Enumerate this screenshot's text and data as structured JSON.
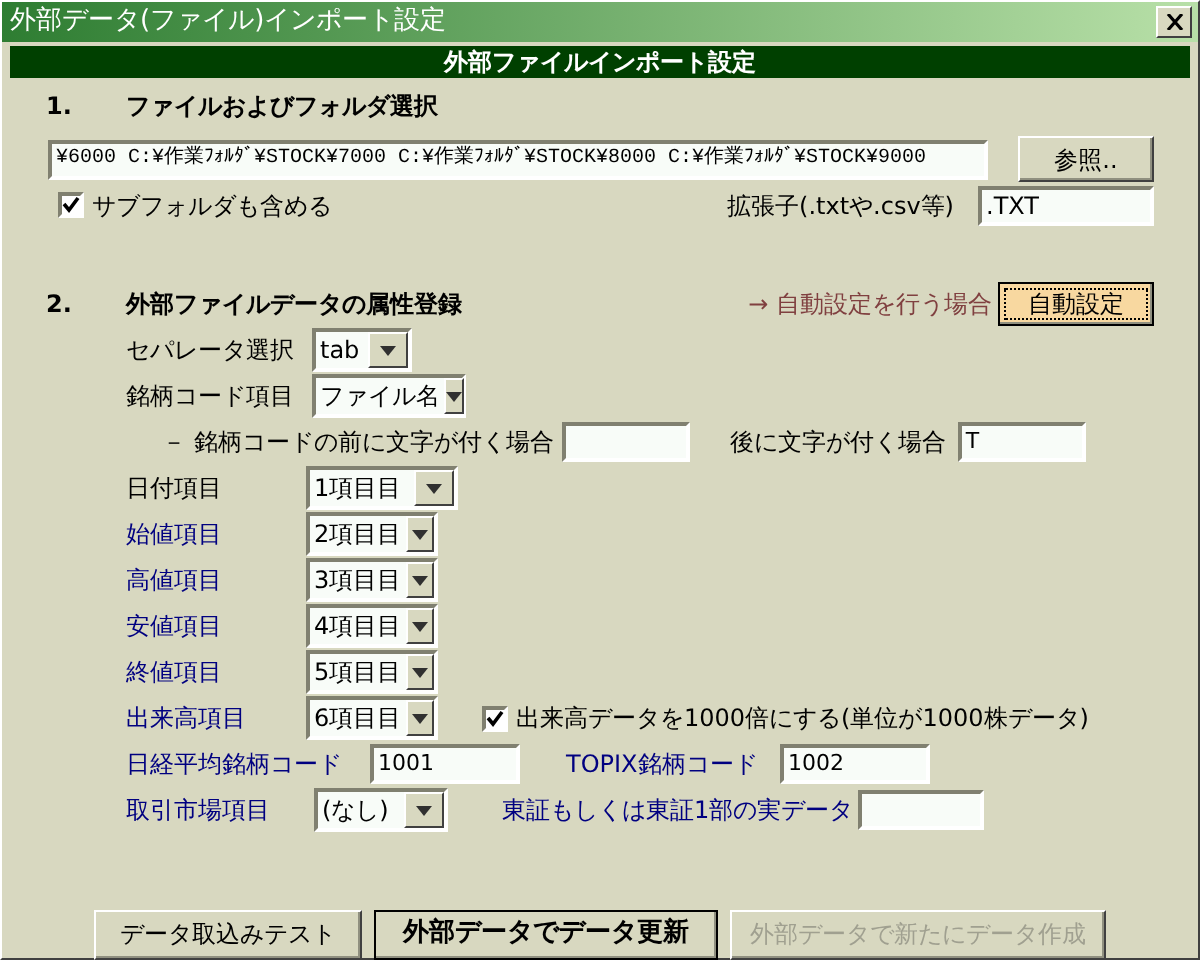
{
  "window": {
    "title": "外部データ(ファイル)インポート設定"
  },
  "header": "外部ファイルインポート設定",
  "section1": {
    "number": "1.",
    "title": "ファイルおよびフォルダ選択",
    "path": "¥6000 C:¥作業ﾌｫﾙﾀﾞ¥STOCK¥7000 C:¥作業ﾌｫﾙﾀﾞ¥STOCK¥8000 C:¥作業ﾌｫﾙﾀﾞ¥STOCK¥9000",
    "browse_button": "参照..",
    "subfolders": {
      "label": "サブフォルダも含める",
      "checked": true
    },
    "extension_label": "拡張子(.txtや.csv等)",
    "extension": ".TXT"
  },
  "section2": {
    "number": "2.",
    "title": "外部ファイルデータの属性登録",
    "auto_hint": "→ 自動設定を行う場合",
    "auto_button": "自動設定",
    "rows": [
      {
        "items": [
          {
            "kind": "label",
            "text": "セパレータ選択",
            "color": "#000000"
          },
          {
            "kind": "select",
            "value": "tab"
          }
        ]
      },
      {
        "items": [
          {
            "kind": "label",
            "text": "銘柄コード項目",
            "color": "#000000"
          },
          {
            "kind": "select",
            "value": "ファイル名"
          }
        ]
      },
      {
        "items": [
          {
            "kind": "label",
            "text": "－ 銘柄コードの前に文字が付く場合",
            "color": "#000000"
          },
          {
            "kind": "input",
            "value": ""
          },
          {
            "kind": "label",
            "text": "後に文字が付く場合",
            "color": "#000000"
          },
          {
            "kind": "input",
            "value": "T"
          }
        ]
      },
      {
        "items": [
          {
            "kind": "label",
            "text": "日付項目",
            "color": "#000000"
          },
          {
            "kind": "select",
            "value": "1項目目"
          }
        ]
      },
      {
        "items": [
          {
            "kind": "label",
            "text": "始値項目",
            "color": "#000080"
          },
          {
            "kind": "select",
            "value": "2項目目"
          }
        ]
      },
      {
        "items": [
          {
            "kind": "label",
            "text": "高値項目",
            "color": "#000080"
          },
          {
            "kind": "select",
            "value": "3項目目"
          }
        ]
      },
      {
        "items": [
          {
            "kind": "label",
            "text": "安値項目",
            "color": "#000080"
          },
          {
            "kind": "select",
            "value": "4項目目"
          }
        ]
      },
      {
        "items": [
          {
            "kind": "label",
            "text": "終値項目",
            "color": "#000080"
          },
          {
            "kind": "select",
            "value": "5項目目"
          }
        ]
      },
      {
        "items": [
          {
            "kind": "label",
            "text": "出来高項目",
            "color": "#000080"
          },
          {
            "kind": "select",
            "value": "6項目目"
          },
          {
            "kind": "checkbox",
            "text": "出来高データを1000倍にする(単位が1000株データ)",
            "checked": true
          }
        ]
      },
      {
        "items": [
          {
            "kind": "label",
            "text": "日経平均銘柄コード",
            "color": "#000080"
          },
          {
            "kind": "input",
            "value": "1001"
          },
          {
            "kind": "label",
            "text": "TOPIX銘柄コード",
            "color": "#000080"
          },
          {
            "kind": "input",
            "value": "1002"
          }
        ]
      },
      {
        "items": [
          {
            "kind": "label",
            "text": "取引市場項目",
            "color": "#000080"
          },
          {
            "kind": "select",
            "value": "(なし)"
          },
          {
            "kind": "label",
            "text": "東証もしくは東証1部の実データ",
            "color": "#000080"
          },
          {
            "kind": "input",
            "value": ""
          }
        ]
      }
    ]
  },
  "buttons": [
    {
      "label": "データ取込みテスト",
      "kind": "normal",
      "disabled": false
    },
    {
      "label": "外部データでデータ更新",
      "kind": "default",
      "disabled": false
    },
    {
      "label": "外部データで新たにデータ作成",
      "kind": "normal",
      "disabled": true
    }
  ]
}
